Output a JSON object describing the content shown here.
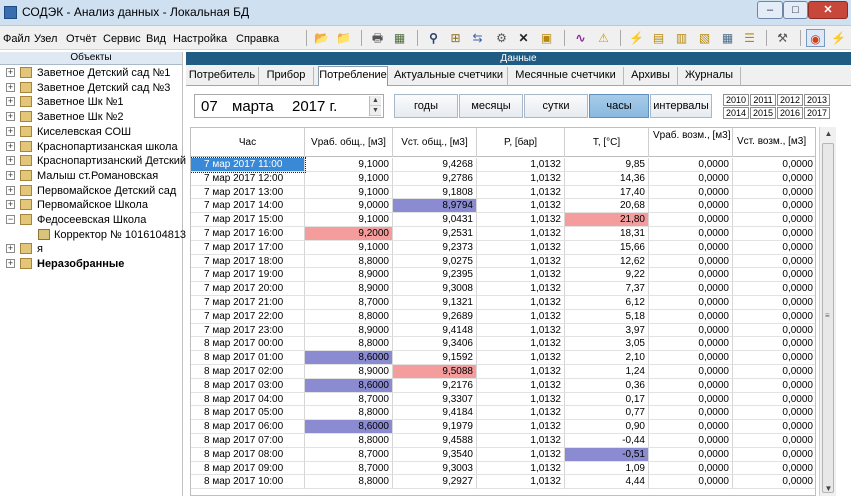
{
  "window": {
    "title": "СОДЭК - Анализ данных - Локальная БД",
    "min_glyph": "–",
    "max_glyph": "□",
    "close_glyph": "✕"
  },
  "menu": [
    "Файл",
    "Узел",
    "Отчёт",
    "Сервис",
    "Вид",
    "Настройка",
    "Справка"
  ],
  "toolbar": [
    {
      "icon": "folder-open-icon",
      "glyph": "📂"
    },
    {
      "icon": "folder-export-icon",
      "glyph": "📁"
    },
    {
      "icon": "print-icon",
      "glyph": "🖶"
    },
    {
      "icon": "calculator-icon",
      "glyph": "▦"
    },
    {
      "icon": "binoculars-icon",
      "glyph": "⚲"
    },
    {
      "icon": "tree-add-icon",
      "glyph": "⊞"
    },
    {
      "icon": "tree-move-icon",
      "glyph": "⇆"
    },
    {
      "icon": "tree-settings-icon",
      "glyph": "⚙"
    },
    {
      "icon": "delete-icon",
      "glyph": "✕"
    },
    {
      "icon": "properties-icon",
      "glyph": "▣"
    },
    {
      "icon": "chart-icon",
      "glyph": "∿"
    },
    {
      "icon": "warning-icon",
      "glyph": "⚠"
    },
    {
      "icon": "lightning-icon",
      "glyph": "⚡"
    },
    {
      "icon": "device-read-icon",
      "glyph": "▤"
    },
    {
      "icon": "device-write-icon",
      "glyph": "▥"
    },
    {
      "icon": "device-sync-icon",
      "glyph": "▧"
    },
    {
      "icon": "table-icon",
      "glyph": "▦"
    },
    {
      "icon": "list-settings-icon",
      "glyph": "☰"
    },
    {
      "icon": "tools-icon",
      "glyph": "⚒"
    },
    {
      "icon": "record-icon",
      "glyph": "◉"
    },
    {
      "icon": "power-icon",
      "glyph": "⚡"
    }
  ],
  "objects": {
    "title": "Объекты",
    "items": [
      {
        "label": "Заветное Детский сад №1",
        "toggle": "+",
        "depth": 0,
        "bold": false
      },
      {
        "label": "Заветное Детский сад №3",
        "toggle": "+",
        "depth": 0,
        "bold": false
      },
      {
        "label": "Заветное Шк №1",
        "toggle": "+",
        "depth": 0,
        "bold": false
      },
      {
        "label": "Заветное Шк №2",
        "toggle": "+",
        "depth": 0,
        "bold": false
      },
      {
        "label": "Киселевская СОШ",
        "toggle": "+",
        "depth": 0,
        "bold": false
      },
      {
        "label": "Краснопартизанская школа",
        "toggle": "+",
        "depth": 0,
        "bold": false
      },
      {
        "label": "Краснопартизанский Детский",
        "toggle": "+",
        "depth": 0,
        "bold": false
      },
      {
        "label": "Малыш ст.Романовская",
        "toggle": "+",
        "depth": 0,
        "bold": false
      },
      {
        "label": "Первомайское Детский сад",
        "toggle": "+",
        "depth": 0,
        "bold": false
      },
      {
        "label": "Первомайское Школа",
        "toggle": "+",
        "depth": 0,
        "bold": false
      },
      {
        "label": "Федосеевская Школа",
        "toggle": "−",
        "depth": 0,
        "bold": false
      },
      {
        "label": "Корректор № 1016104813",
        "toggle": "",
        "depth": 1,
        "bold": false
      },
      {
        "label": "я",
        "toggle": "+",
        "depth": 0,
        "bold": false
      },
      {
        "label": "Неразобранные",
        "toggle": "+",
        "depth": 0,
        "bold": true
      }
    ]
  },
  "data_panel": {
    "title": "Данные",
    "tabs": [
      "Потребитель",
      "Прибор",
      "Потребление",
      "Актуальные счетчики",
      "Месячные счетчики",
      "Архивы",
      "Журналы"
    ],
    "active_tab": "Потребление"
  },
  "controls": {
    "date": {
      "day": "07",
      "month": "марта",
      "year": "2017 г."
    },
    "spin_up": "▲",
    "spin_down": "▼",
    "periods": [
      "годы",
      "месяцы",
      "сутки",
      "часы",
      "интервалы"
    ],
    "active_period": "часы",
    "years": [
      "2010",
      "2011",
      "2012",
      "2013",
      "2014",
      "2015",
      "2016",
      "2017"
    ]
  },
  "table": {
    "columns": [
      "Час",
      "Vраб. общ., [м3]",
      "Vст. общ., [м3]",
      "P, [бар]",
      "T, [°C]",
      "Vраб. возм., [м3]",
      "Vст. возм., [м3]"
    ],
    "rows": [
      [
        "7 мар 2017  11:00",
        "9,1000",
        "9,4268",
        "1,0132",
        "9,85",
        "0,0000",
        "0,0000"
      ],
      [
        "7 мар 2017  12:00",
        "9,1000",
        "9,2786",
        "1,0132",
        "14,36",
        "0,0000",
        "0,0000"
      ],
      [
        "7 мар 2017  13:00",
        "9,1000",
        "9,1808",
        "1,0132",
        "17,40",
        "0,0000",
        "0,0000"
      ],
      [
        "7 мар 2017  14:00",
        "9,0000",
        "8,9794",
        "1,0132",
        "20,68",
        "0,0000",
        "0,0000"
      ],
      [
        "7 мар 2017  15:00",
        "9,1000",
        "9,0431",
        "1,0132",
        "21,80",
        "0,0000",
        "0,0000"
      ],
      [
        "7 мар 2017  16:00",
        "9,2000",
        "9,2531",
        "1,0132",
        "18,31",
        "0,0000",
        "0,0000"
      ],
      [
        "7 мар 2017  17:00",
        "9,1000",
        "9,2373",
        "1,0132",
        "15,66",
        "0,0000",
        "0,0000"
      ],
      [
        "7 мар 2017  18:00",
        "8,8000",
        "9,0275",
        "1,0132",
        "12,62",
        "0,0000",
        "0,0000"
      ],
      [
        "7 мар 2017  19:00",
        "8,9000",
        "9,2395",
        "1,0132",
        "9,22",
        "0,0000",
        "0,0000"
      ],
      [
        "7 мар 2017  20:00",
        "8,9000",
        "9,3008",
        "1,0132",
        "7,37",
        "0,0000",
        "0,0000"
      ],
      [
        "7 мар 2017  21:00",
        "8,7000",
        "9,1321",
        "1,0132",
        "6,12",
        "0,0000",
        "0,0000"
      ],
      [
        "7 мар 2017  22:00",
        "8,8000",
        "9,2689",
        "1,0132",
        "5,18",
        "0,0000",
        "0,0000"
      ],
      [
        "7 мар 2017  23:00",
        "8,9000",
        "9,4148",
        "1,0132",
        "3,97",
        "0,0000",
        "0,0000"
      ],
      [
        "8 мар 2017  00:00",
        "8,8000",
        "9,3406",
        "1,0132",
        "3,05",
        "0,0000",
        "0,0000"
      ],
      [
        "8 мар 2017  01:00",
        "8,6000",
        "9,1592",
        "1,0132",
        "2,10",
        "0,0000",
        "0,0000"
      ],
      [
        "8 мар 2017  02:00",
        "8,9000",
        "9,5088",
        "1,0132",
        "1,24",
        "0,0000",
        "0,0000"
      ],
      [
        "8 мар 2017  03:00",
        "8,6000",
        "9,2176",
        "1,0132",
        "0,36",
        "0,0000",
        "0,0000"
      ],
      [
        "8 мар 2017  04:00",
        "8,7000",
        "9,3307",
        "1,0132",
        "0,17",
        "0,0000",
        "0,0000"
      ],
      [
        "8 мар 2017  05:00",
        "8,8000",
        "9,4184",
        "1,0132",
        "0,77",
        "0,0000",
        "0,0000"
      ],
      [
        "8 мар 2017  06:00",
        "8,6000",
        "9,1979",
        "1,0132",
        "0,90",
        "0,0000",
        "0,0000"
      ],
      [
        "8 мар 2017  07:00",
        "8,8000",
        "9,4588",
        "1,0132",
        "-0,44",
        "0,0000",
        "0,0000"
      ],
      [
        "8 мар 2017  08:00",
        "8,7000",
        "9,3540",
        "1,0132",
        "-0,51",
        "0,0000",
        "0,0000"
      ],
      [
        "8 мар 2017  09:00",
        "8,7000",
        "9,3003",
        "1,0132",
        "1,09",
        "0,0000",
        "0,0000"
      ],
      [
        "8 мар 2017  10:00",
        "8,8000",
        "9,2927",
        "1,0132",
        "4,44",
        "0,0000",
        "0,0000"
      ]
    ],
    "highlights": [
      {
        "row": 3,
        "col": 2,
        "kind": "low"
      },
      {
        "row": 4,
        "col": 4,
        "kind": "high"
      },
      {
        "row": 5,
        "col": 1,
        "kind": "high"
      },
      {
        "row": 14,
        "col": 1,
        "kind": "low"
      },
      {
        "row": 15,
        "col": 2,
        "kind": "high"
      },
      {
        "row": 16,
        "col": 1,
        "kind": "low"
      },
      {
        "row": 19,
        "col": 1,
        "kind": "low"
      },
      {
        "row": 21,
        "col": 4,
        "kind": "low"
      }
    ],
    "selected_row": 0
  },
  "scrollbar": {
    "up": "▲",
    "down": "▼",
    "grip": "≡"
  },
  "colors": {
    "accent": "#1f5b83",
    "highlight_low": "#8b8bd1",
    "highlight_high": "#f59c9c",
    "selection": "#3a89d6"
  }
}
